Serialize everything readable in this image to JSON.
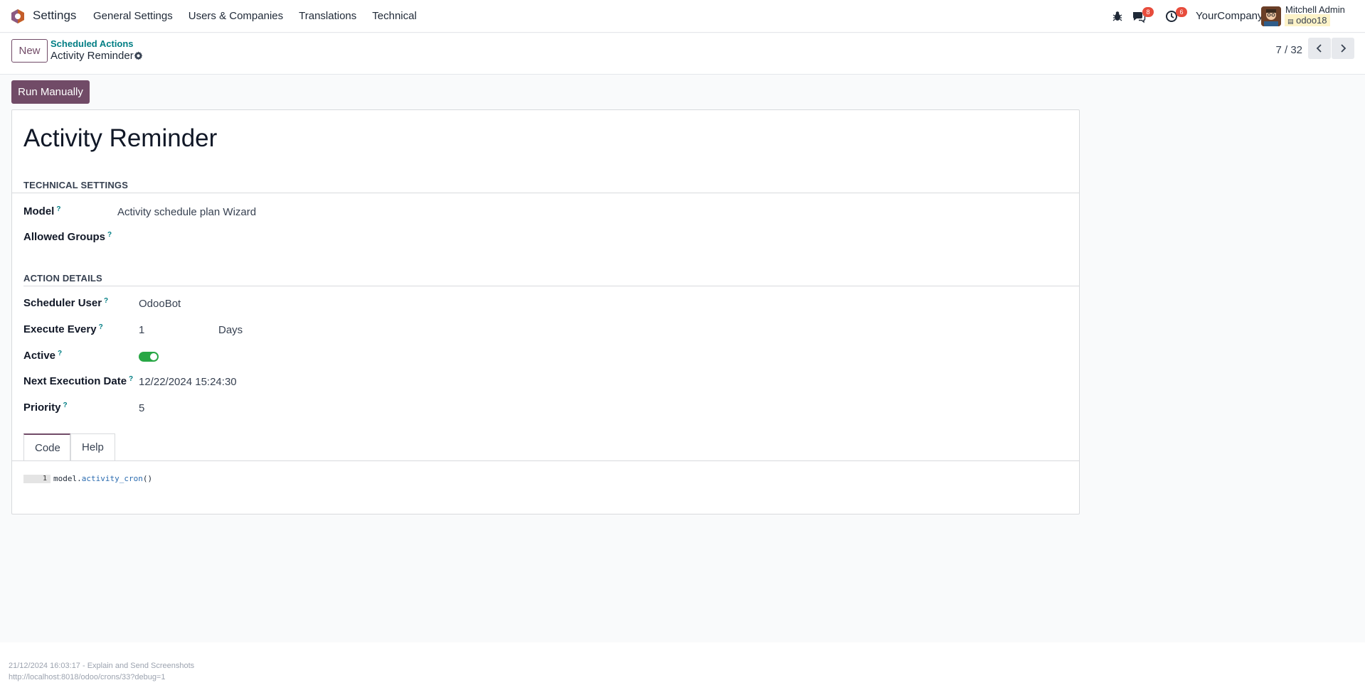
{
  "navbar": {
    "app_name": "Settings",
    "menu": [
      "General Settings",
      "Users & Companies",
      "Translations",
      "Technical"
    ],
    "messages_count": "8",
    "activities_count": "6",
    "company": "YourCompany",
    "user_name": "Mitchell Admin",
    "database": "odoo18"
  },
  "control_panel": {
    "new_label": "New",
    "breadcrumb_parent": "Scheduled Actions",
    "breadcrumb_current": "Activity Reminder",
    "pager": "7 / 32"
  },
  "actions": {
    "run_manually_label": "Run Manually"
  },
  "form": {
    "title": "Activity Reminder",
    "technical_settings": {
      "heading": "TECHNICAL SETTINGS",
      "model_label": "Model",
      "model_value": "Activity schedule plan Wizard",
      "allowed_groups_label": "Allowed Groups",
      "allowed_groups_value": ""
    },
    "action_details": {
      "heading": "ACTION DETAILS",
      "scheduler_user_label": "Scheduler User",
      "scheduler_user_value": "OdooBot",
      "execute_every_label": "Execute Every",
      "execute_every_number": "1",
      "execute_every_unit": "Days",
      "active_label": "Active",
      "active_value": true,
      "next_execution_label": "Next Execution Date",
      "next_execution_value": "12/22/2024 15:24:30",
      "priority_label": "Priority",
      "priority_value": "5"
    },
    "help_mark": "?",
    "tabs": [
      "Code",
      "Help"
    ],
    "active_tab": "Code",
    "code": {
      "line_number": "1",
      "object": "model",
      "dot": ".",
      "method": "activity_cron",
      "parens": "()"
    }
  },
  "footer": {
    "line1": "21/12/2024 16:03:17 - Explain and Send Screenshots",
    "line2": "http://localhost:8018/odoo/crons/33?debug=1"
  },
  "colors": {
    "brand": "#714b67",
    "link": "#017e84",
    "toggle_on": "#28a745",
    "badge": "#e74c3c"
  }
}
